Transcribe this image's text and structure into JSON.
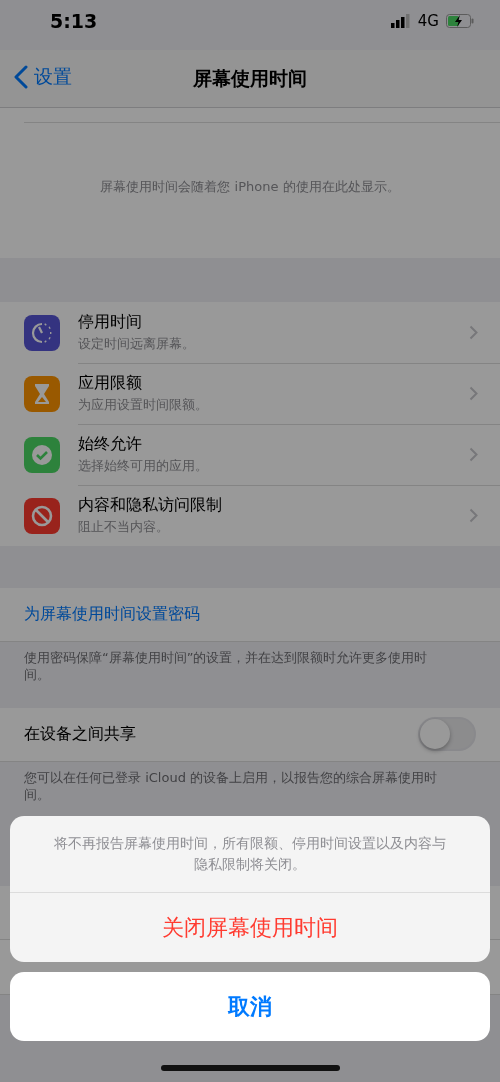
{
  "status_bar": {
    "time": "5:13",
    "network": "4G"
  },
  "nav": {
    "back": "设置",
    "title": "屏幕使用时间"
  },
  "usage_placeholder": "屏幕使用时间会随着您 iPhone 的使用在此处显示。",
  "items": [
    {
      "kind": "downtime",
      "title": "停用时间",
      "subtitle": "设定时间远离屏幕。"
    },
    {
      "kind": "app_limits",
      "title": "应用限额",
      "subtitle": "为应用设置时间限额。"
    },
    {
      "kind": "always_allowed",
      "title": "始终允许",
      "subtitle": "选择始终可用的应用。"
    },
    {
      "kind": "restrictions",
      "title": "内容和隐私访问限制",
      "subtitle": "阻止不当内容。"
    }
  ],
  "passcode": {
    "link": "为屏幕使用时间设置密码",
    "footer": "使用密码保障“屏幕使用时间”的设置，并在达到限额时允许更多使用时间。"
  },
  "share": {
    "label": "在设备之间共享",
    "on": false,
    "footer": "您可以在任何已登录 iCloud 的设备上启用，以报告您的综合屏幕使用时间。"
  },
  "action_sheet": {
    "message": "将不再报告屏幕使用时间，所有限额、停用时间设置以及内容与隐私限制将关闭。",
    "action": "关闭屏幕使用时间",
    "cancel": "取消"
  }
}
